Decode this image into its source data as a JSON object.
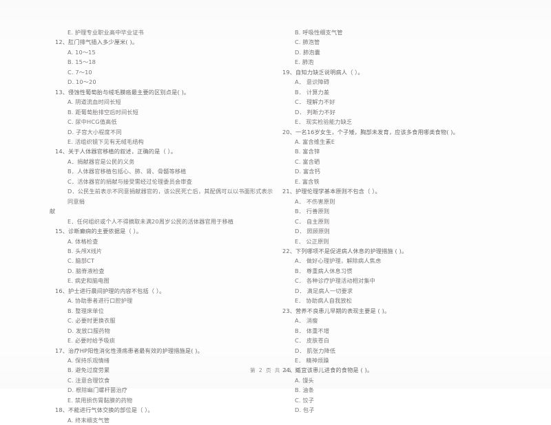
{
  "document": {
    "page_label": "第 2 页  共 15 页"
  },
  "left_column": [
    {
      "type": "option",
      "text": "E. 护理专业职业高中毕业证书"
    },
    {
      "type": "question",
      "text": "12、肛门排气插入多少厘米(      )。"
    },
    {
      "type": "option",
      "text": "A. 10～15"
    },
    {
      "type": "option",
      "text": "B. 15～18"
    },
    {
      "type": "option",
      "text": "C. 7～10"
    },
    {
      "type": "option",
      "text": "D. 10～20"
    },
    {
      "type": "question",
      "text": "13、侵蚀性葡萄胎与绒毛膜癌最主要的区别点是(       )。"
    },
    {
      "type": "option",
      "text": "A. 阴道流血时间长短"
    },
    {
      "type": "option",
      "text": "B. 距葡萄胎排空后时间长短"
    },
    {
      "type": "option",
      "text": "C. 尿中HCG值高低"
    },
    {
      "type": "option",
      "text": "D. 子宫大小程度不同"
    },
    {
      "type": "option",
      "text": "E. 活组织镜下见有无绒毛结构"
    },
    {
      "type": "question",
      "text": "14、关于人体器官移植的叙述，正确的是（       ）。"
    },
    {
      "type": "option",
      "text": "A．捐献器官是公民的义务"
    },
    {
      "type": "option",
      "text": "B．人体器官移植包括心、肺、肾、骨髓等移植"
    },
    {
      "type": "option",
      "text": "C．活体器官的捐献与接受需经过伦理委员会审查"
    },
    {
      "type": "option_wrap",
      "text": "D．公民生前表示不同意捐献器官的，该公民死亡后，其配偶可以以书面形式表示同意捐"
    },
    {
      "type": "hang",
      "text": "献"
    },
    {
      "type": "option",
      "text": "E．任何组织或个人不得摘取未满20周岁公民的活体器官用于移植"
    },
    {
      "type": "question",
      "text": "15、诊断癫痫的主要依据是（      ）。"
    },
    {
      "type": "option",
      "text": "A. 体格检查"
    },
    {
      "type": "option",
      "text": "B. 头颅X线片"
    },
    {
      "type": "option",
      "text": "C. 脑部CT"
    },
    {
      "type": "option",
      "text": "D. 脑脊液检查"
    },
    {
      "type": "option",
      "text": "E. 病史和脑电图"
    },
    {
      "type": "question",
      "text": "16、护士进行晨间护理的内容不包括（      ）。"
    },
    {
      "type": "option",
      "text": "A. 协助患者进行口腔护理"
    },
    {
      "type": "option",
      "text": "B. 整理床单位"
    },
    {
      "type": "option",
      "text": "C. 必要时更换衣服"
    },
    {
      "type": "option",
      "text": "D. 发放口服药物"
    },
    {
      "type": "option",
      "text": "E. 必要时给予吸痰"
    },
    {
      "type": "question",
      "text": "17、治疗HP阳性消化性溃疡患者最有效的护理措施是(       )。"
    },
    {
      "type": "option",
      "text": "A. 保持乐观情绪"
    },
    {
      "type": "option",
      "text": "B. 避免过度劳累"
    },
    {
      "type": "option",
      "text": "C. 注意合理饮食"
    },
    {
      "type": "option",
      "text": "D. 根除幽门螺杆菌治疗"
    },
    {
      "type": "option",
      "text": "E. 禁用损伤胃黏膜的药物"
    },
    {
      "type": "question",
      "text": "18、不能进行气体交换的部位是（      ）。"
    },
    {
      "type": "option",
      "text": "A. 终末细支气管"
    }
  ],
  "right_column": [
    {
      "type": "option",
      "text": "B. 呼吸性细支气管"
    },
    {
      "type": "option",
      "text": "C. 肺泡管"
    },
    {
      "type": "option",
      "text": "D. 肺泡囊"
    },
    {
      "type": "option",
      "text": "E. 肺泡"
    },
    {
      "type": "question",
      "text": "19、自知力缺乏说明病人（       ）。"
    },
    {
      "type": "option",
      "text": "A． 意识障碍"
    },
    {
      "type": "option",
      "text": "B． 计算力差"
    },
    {
      "type": "option",
      "text": "C． 理解力不好"
    },
    {
      "type": "option",
      "text": "D． 判断力不好"
    },
    {
      "type": "option",
      "text": "E． 现实检验能力缺乏"
    },
    {
      "type": "question",
      "text": "20、一名16岁女生，个子矮，胸部未发育，应该多食用哪类食物(       )。"
    },
    {
      "type": "option",
      "text": "A. 富含维生素E"
    },
    {
      "type": "option",
      "text": "B. 富含锌"
    },
    {
      "type": "option",
      "text": "C. 富含硒"
    },
    {
      "type": "option",
      "text": "D. 富含钙"
    },
    {
      "type": "option",
      "text": "E. 富含铁"
    },
    {
      "type": "question",
      "text": "21、护理伦理学基本原则不包含（      ）。"
    },
    {
      "type": "option",
      "text": "A． 不伤害原则"
    },
    {
      "type": "option",
      "text": "B． 行善原则"
    },
    {
      "type": "option",
      "text": "C． 自主原则"
    },
    {
      "type": "option",
      "text": "D． 照顾原则"
    },
    {
      "type": "option",
      "text": "E． 公正原则"
    },
    {
      "type": "question",
      "text": "22、下列哪项不是促进病人休息的护理措施 (       )。"
    },
    {
      "type": "option",
      "text": "A． 做好心理护理，解除病人焦虑"
    },
    {
      "type": "option",
      "text": "B． 尊重病人休息习惯"
    },
    {
      "type": "option",
      "text": "C． 各种诊疗护理活动相对集中"
    },
    {
      "type": "option",
      "text": "D． 满足病人一切要求"
    },
    {
      "type": "option",
      "text": "E． 协助病人自我放松"
    },
    {
      "type": "question",
      "text": "23、营养不良患儿早期的表现主要是 (      )。"
    },
    {
      "type": "option",
      "text": "A． 消瘦"
    },
    {
      "type": "option",
      "text": "B． 体重不增"
    },
    {
      "type": "option",
      "text": "C． 皮肤苍白"
    },
    {
      "type": "option",
      "text": "D． 肌张力降低"
    },
    {
      "type": "option",
      "text": "E． 精神烦躁"
    },
    {
      "type": "question",
      "text": "24、适宜该患儿进食的食物是 (      )。"
    },
    {
      "type": "option",
      "text": "A. 馒头"
    },
    {
      "type": "option",
      "text": "B. 油条"
    },
    {
      "type": "option",
      "text": "C. 饺子"
    },
    {
      "type": "option",
      "text": "D. 包子"
    }
  ]
}
